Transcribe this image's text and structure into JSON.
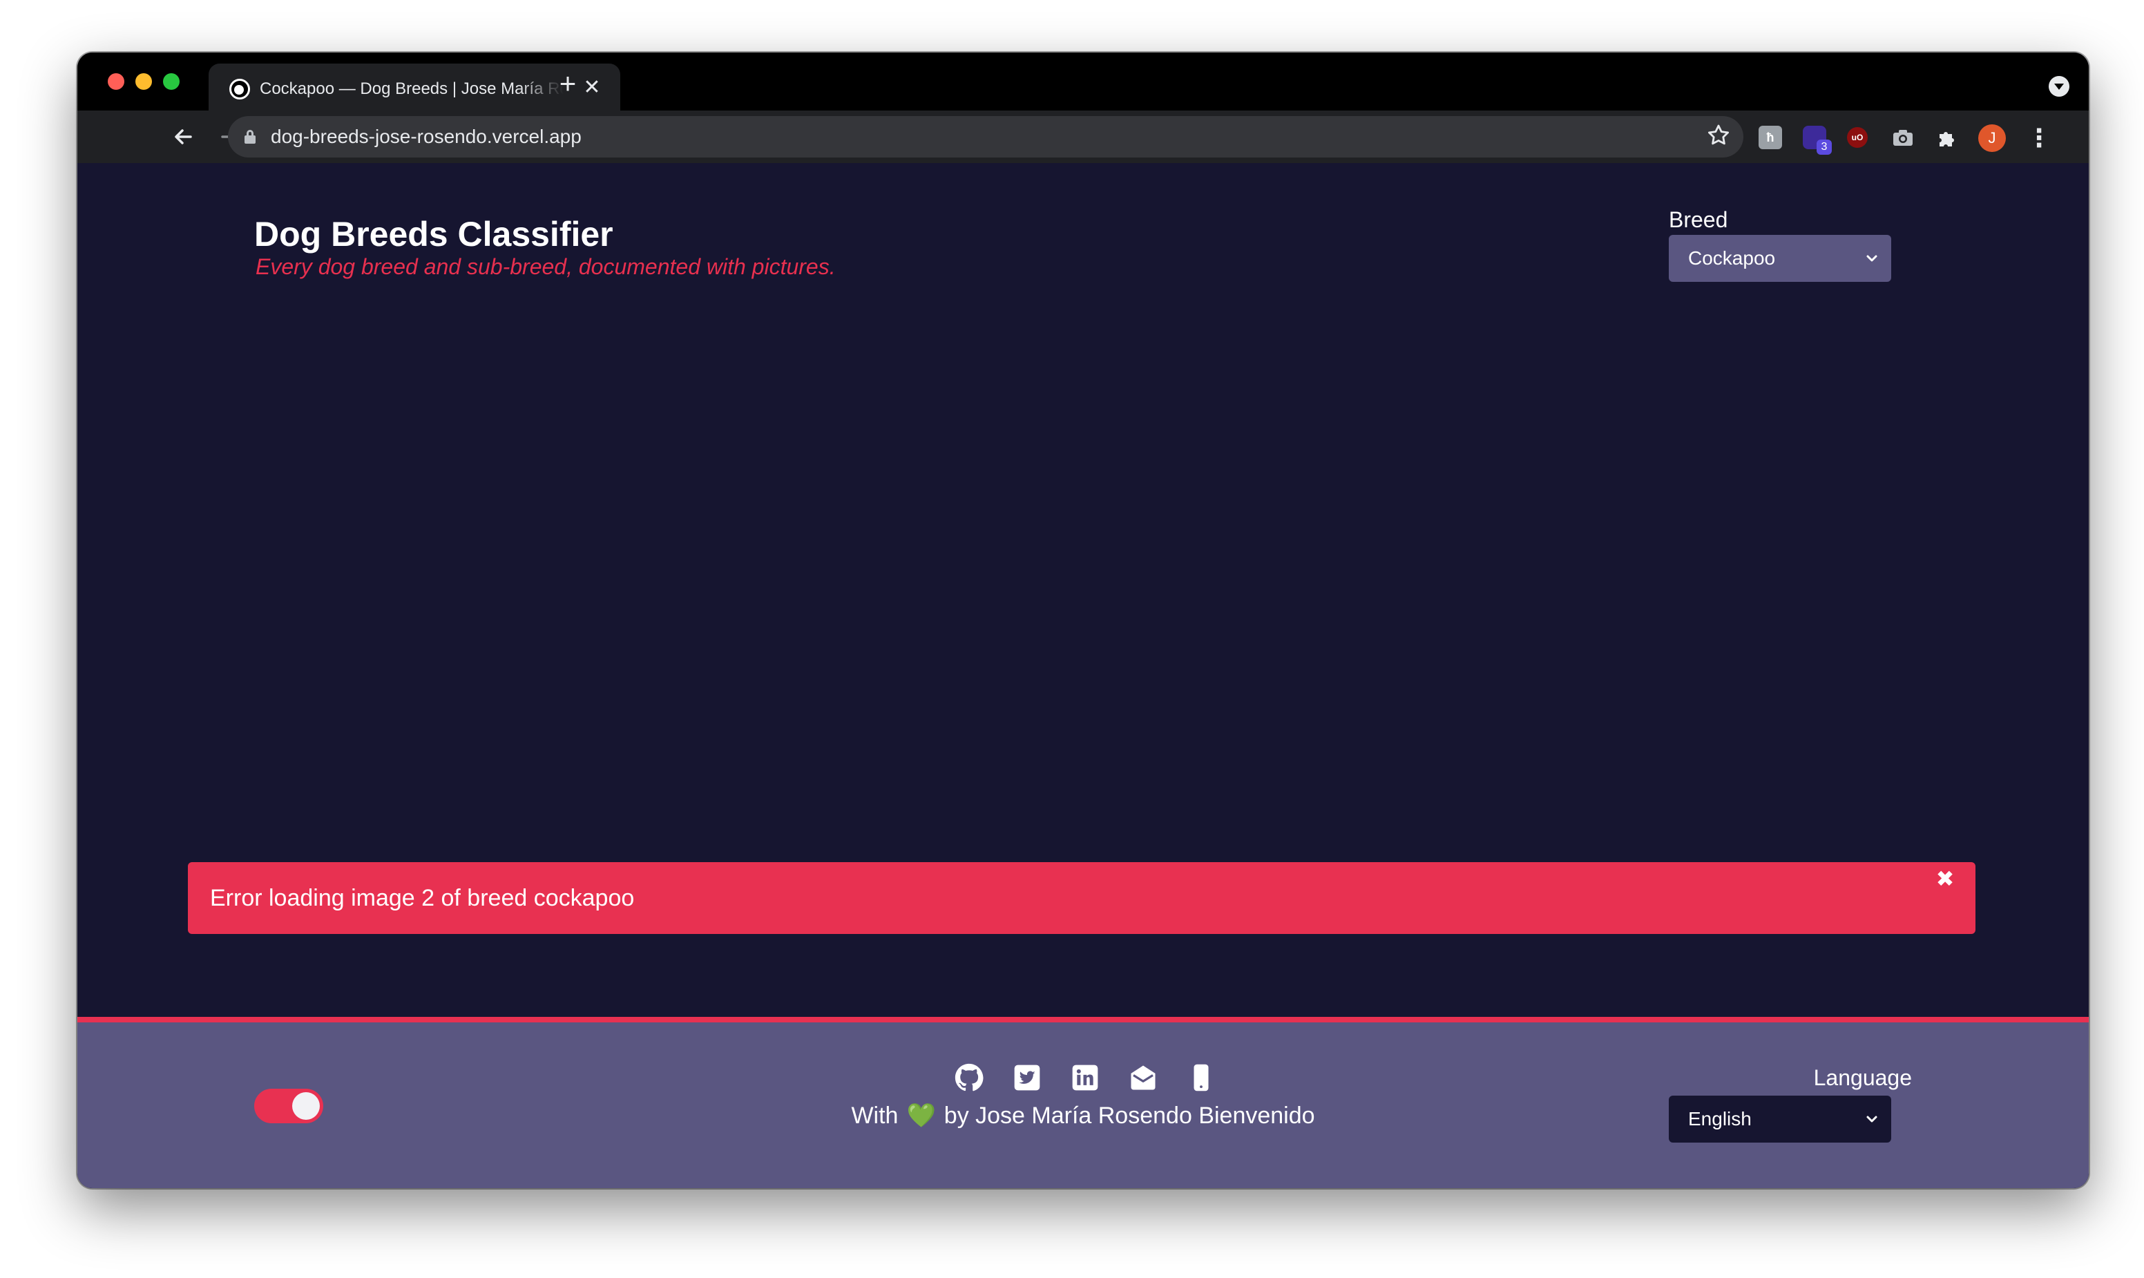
{
  "browser": {
    "tab_title": "Cockapoo — Dog Breeds | Jose María Rosendo",
    "tab_close_glyph": "✕",
    "new_tab_glyph": "+",
    "url": "dog-breeds-jose-rosendo.vercel.app",
    "extension_badge": "3",
    "extension_one": "ћ",
    "extension_ublock": "uO",
    "profile_initial": "J",
    "icons": [
      "back-icon",
      "forward-icon",
      "reload-icon",
      "lock-icon",
      "star-icon",
      "camera-icon",
      "puzzle-icon",
      "kebab-menu-icon"
    ]
  },
  "header": {
    "title": "Dog Breeds Classifier",
    "subtitle": "Every dog breed and sub-breed, documented with pictures.",
    "breed_label": "Breed",
    "breed_selected": "Cockapoo"
  },
  "error": {
    "message": "Error loading image 2 of breed cockapoo",
    "close_glyph": "✖"
  },
  "footer": {
    "credit_prefix": "With",
    "credit_heart": "💚",
    "credit_suffix": "by Jose María Rosendo Bienvenido",
    "language_label": "Language",
    "language_selected": "English",
    "social_icons": [
      "github-icon",
      "twitter-icon",
      "linkedin-icon",
      "email-icon",
      "phone-icon"
    ]
  },
  "colors": {
    "page_background": "#161530",
    "accent": "#e83151",
    "footer_background": "#5a5681",
    "select_background": "#5a5681",
    "heart": "#35c43c"
  }
}
